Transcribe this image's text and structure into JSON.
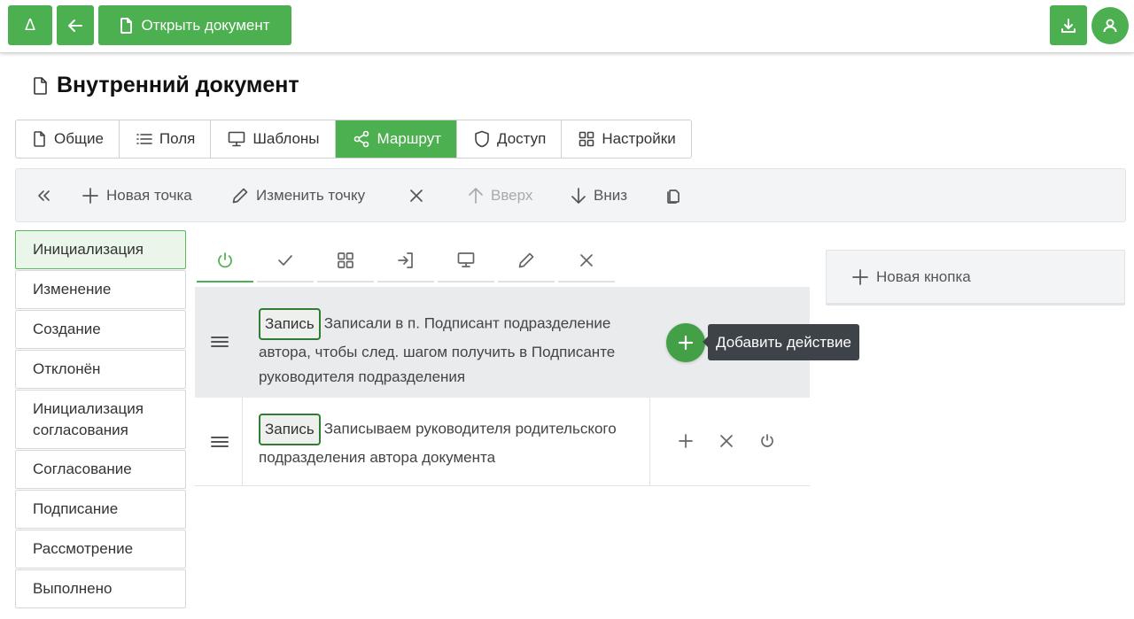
{
  "topbar": {
    "delta_label": "Δ",
    "open_document_label": "Открыть документ"
  },
  "page": {
    "title": "Внутренний документ"
  },
  "tabs": [
    {
      "label": "Общие",
      "icon": "file-icon",
      "active": false
    },
    {
      "label": "Поля",
      "icon": "list-icon",
      "active": false
    },
    {
      "label": "Шаблоны",
      "icon": "monitor-icon",
      "active": false
    },
    {
      "label": "Маршрут",
      "icon": "share-icon",
      "active": true
    },
    {
      "label": "Доступ",
      "icon": "shield-icon",
      "active": false
    },
    {
      "label": "Настройки",
      "icon": "grid-icon",
      "active": false
    }
  ],
  "toolbar": {
    "new_point": "Новая точка",
    "edit_point": "Изменить точку",
    "up": "Вверх",
    "down": "Вниз"
  },
  "stages": [
    {
      "label": "Инициализация",
      "active": true
    },
    {
      "label": "Изменение",
      "active": false
    },
    {
      "label": "Создание",
      "active": false
    },
    {
      "label": "Отклонён",
      "active": false
    },
    {
      "label": "Инициализация согласования",
      "active": false
    },
    {
      "label": "Согласование",
      "active": false
    },
    {
      "label": "Подписание",
      "active": false
    },
    {
      "label": "Рассмотрение",
      "active": false
    },
    {
      "label": "Выполнено",
      "active": false
    }
  ],
  "icon_tabs": [
    "power-icon",
    "check-icon",
    "grid-icon",
    "login-icon",
    "monitor-icon",
    "pencil-icon",
    "close-icon"
  ],
  "actions": [
    {
      "badge": "Запись",
      "text": "Записали в п. Подписант подразделение автора, чтобы след. шагом получить в Подписанте руководителя подразделения"
    },
    {
      "badge": "Запись",
      "text": "Записываем руководителя родительского подразделения автора документа"
    }
  ],
  "tooltip": "Добавить действие",
  "right_panel": {
    "new_button_label": "Новая кнопка"
  },
  "colors": {
    "accent": "#4caf50",
    "badge_border": "#2e7d32",
    "tooltip_bg": "#3d4348"
  }
}
